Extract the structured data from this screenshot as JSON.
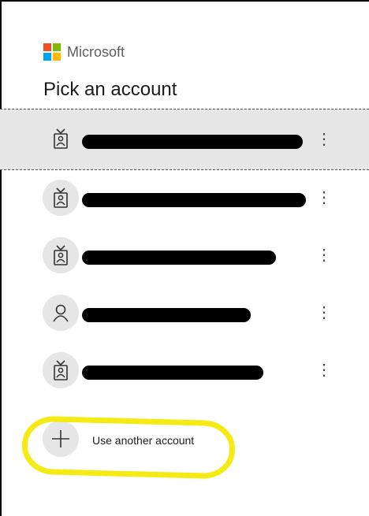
{
  "brand": {
    "name": "Microsoft",
    "logo_colors": [
      "#f25022",
      "#7fba00",
      "#00a4ef",
      "#ffb900"
    ]
  },
  "title": "Pick an account",
  "accounts": [
    {
      "icon": "work-badge-icon",
      "name": "",
      "redacted": true,
      "selected": true
    },
    {
      "icon": "work-badge-icon",
      "name": "",
      "redacted": true,
      "selected": false
    },
    {
      "icon": "work-badge-icon",
      "name": "",
      "redacted": true,
      "selected": false
    },
    {
      "icon": "person-icon",
      "name": "",
      "redacted": true,
      "selected": false
    },
    {
      "icon": "work-badge-icon",
      "name": "",
      "redacted": true,
      "selected": false
    }
  ],
  "more_options_glyph": "⋮",
  "add_account": {
    "icon": "plus-icon",
    "label": "Use another account"
  },
  "colors": {
    "selected_row_bg": "#e6e6e6",
    "avatar_bg": "#e6e6e6",
    "annotation_highlight": "#f5ea14",
    "redaction": "#000000"
  }
}
